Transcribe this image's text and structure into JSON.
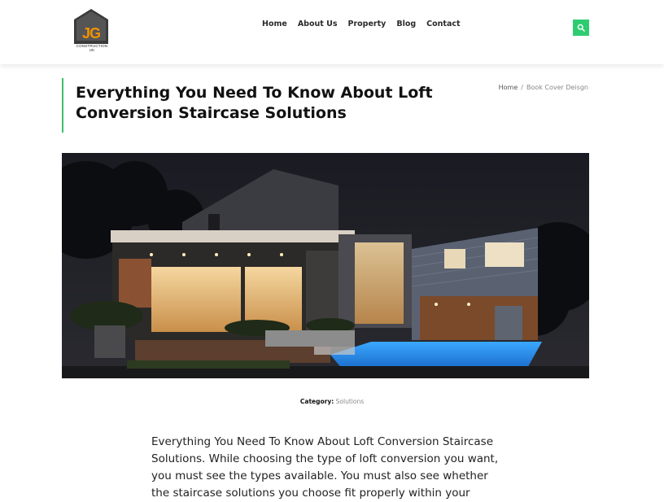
{
  "logo": {
    "initials": "JG",
    "subtitle": "CONSTRUCTION UK"
  },
  "nav": {
    "items": [
      "Home",
      "About Us",
      "Property",
      "Blog",
      "Contact"
    ]
  },
  "search": {
    "icon": "search-icon"
  },
  "colors": {
    "accent": "#2ecc71",
    "logo_orange": "#f39200"
  },
  "page": {
    "title": "Everything You Need To Know About Loft Conversion Staircase Solutions"
  },
  "breadcrumb": {
    "home": "Home",
    "separator": "/",
    "current": "Book Cover Deisgn"
  },
  "post": {
    "category_label": "Category:",
    "category_value": "Solutions",
    "body": "Everything You Need To Know About Loft Conversion Staircase Solutions. While choosing the type of loft conversion you want, you must see the types available. You must also see whether the staircase solutions you choose fit properly within your"
  }
}
